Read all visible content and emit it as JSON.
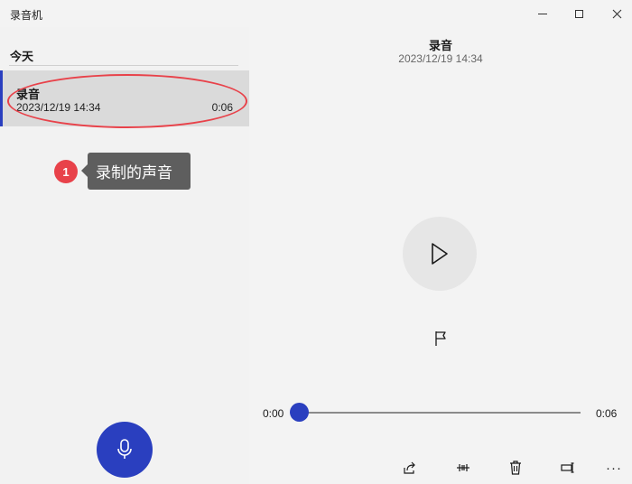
{
  "window": {
    "title": "录音机"
  },
  "list": {
    "section_header": "今天",
    "items": [
      {
        "name": "录音",
        "date": "2023/12/19 14:34",
        "duration": "0:06"
      }
    ]
  },
  "annotation": {
    "number": "1",
    "text": "录制的声音",
    "color": "#e8424a"
  },
  "detail": {
    "title": "录音",
    "date": "2023/12/19 14:34"
  },
  "player": {
    "current_time": "0:00",
    "total_time": "0:06",
    "progress": 0
  },
  "toolbar": {
    "icons": [
      "share-icon",
      "trim-icon",
      "delete-icon",
      "rename-icon",
      "more-icon"
    ],
    "more_label": "···"
  },
  "colors": {
    "accent": "#2a3fbf",
    "selected_bg": "#dadada"
  }
}
